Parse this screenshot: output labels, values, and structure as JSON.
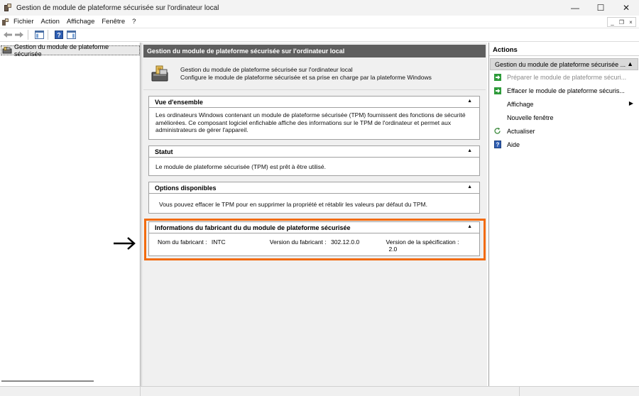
{
  "window": {
    "title": "Gestion de module de plateforme sécurisée sur l'ordinateur local",
    "minimize": "—",
    "maximize": "☐",
    "close": "✕"
  },
  "menu": {
    "items": [
      "Fichier",
      "Action",
      "Affichage",
      "Fenêtre",
      "?"
    ],
    "mdi_minimize": "_",
    "mdi_restore": "❐",
    "mdi_close": "×"
  },
  "tree": {
    "item_label": "Gestion du module de plateforme sécurisée"
  },
  "center": {
    "header": "Gestion du module de plateforme sécurisée sur l'ordinateur local",
    "intro_line1": "Gestion du module de plateforme sécurisée sur l'ordinateur local",
    "intro_line2": "Configure le module de plateforme sécurisée et sa prise en charge par la plateforme Windows",
    "overview": {
      "title": "Vue d'ensemble",
      "body": "Les ordinateurs Windows contenant un module de plateforme sécurisée (TPM) fournissent des fonctions de sécurité améliorées. Ce composant logiciel enfichable affiche des informations sur le TPM de l'ordinateur et permet aux administrateurs de gérer l'appareil."
    },
    "status": {
      "title": "Statut",
      "body": "Le module de plateforme sécurisée (TPM) est prêt à être utilisé."
    },
    "options": {
      "title": "Options disponibles",
      "body": "Vous pouvez effacer le TPM pour en supprimer la propriété et rétablir les valeurs par défaut du TPM."
    },
    "manufacturer": {
      "title": "Informations du fabricant du du module de plateforme sécurisée",
      "name_label": "Nom du fabricant :",
      "name_value": "INTC",
      "version_label": "Version du fabricant :",
      "version_value": "302.12.0.0",
      "spec_label": "Version de la spécification :",
      "spec_value": "2.0"
    },
    "collapse_glyph": "▲"
  },
  "actions": {
    "title": "Actions",
    "group_label": "Gestion du module de plateforme sécurisée ...",
    "items": [
      {
        "label": "Préparer le module de plateforme sécuri...",
        "enabled": false,
        "icon": "green-arrow-icon"
      },
      {
        "label": "Effacer le module de plateforme sécuris...",
        "enabled": true,
        "icon": "green-arrow-icon"
      },
      {
        "label": "Affichage",
        "enabled": true,
        "icon": "none"
      },
      {
        "label": "Nouvelle fenêtre",
        "enabled": true,
        "icon": "none"
      },
      {
        "label": "Actualiser",
        "enabled": true,
        "icon": "refresh-icon"
      },
      {
        "label": "Aide",
        "enabled": true,
        "icon": "help-icon"
      }
    ]
  },
  "colors": {
    "highlight": "#f26b0f",
    "header_bg": "#5f5f5f",
    "action_green": "#2e9b3a"
  }
}
